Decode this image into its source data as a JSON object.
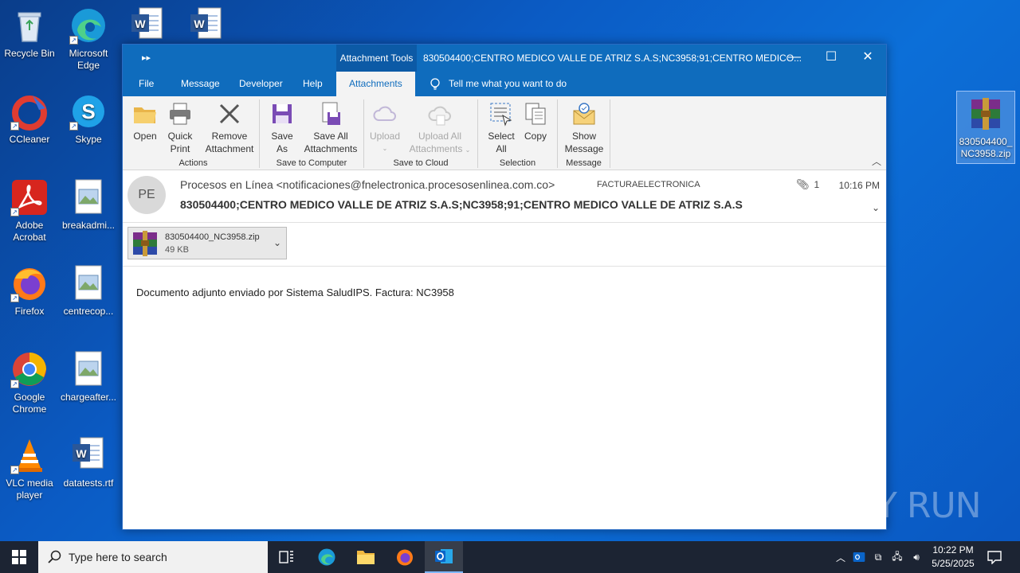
{
  "desktop": {
    "icons": [
      {
        "label": "Recycle Bin"
      },
      {
        "label": "Microsoft Edge"
      },
      {
        "label": "CCleaner"
      },
      {
        "label": "Skype"
      },
      {
        "label": "Adobe Acrobat"
      },
      {
        "label": "breakadmi..."
      },
      {
        "label": "Firefox"
      },
      {
        "label": "centrecop..."
      },
      {
        "label": "Google Chrome"
      },
      {
        "label": "chargeafter..."
      },
      {
        "label": "VLC media player"
      },
      {
        "label": "datatests.rtf"
      },
      {
        "label": "830504400_NC3958.zip"
      }
    ]
  },
  "window": {
    "contextual_tab": "Attachment Tools",
    "title": "830504400;CENTRO MEDICO VALLE DE ATRIZ S.A.S;NC3958;91;CENTRO MEDICO...",
    "tabs": [
      "File",
      "Message",
      "Developer",
      "Help",
      "Attachments"
    ],
    "active_tab": "Attachments",
    "tell_me": "Tell me what you want to do"
  },
  "ribbon": {
    "groups": {
      "actions": "Actions",
      "save_to_computer": "Save to Computer",
      "save_to_cloud": "Save to Cloud",
      "selection": "Selection",
      "message": "Message"
    },
    "buttons": {
      "open": "Open",
      "quick_print_1": "Quick",
      "quick_print_2": "Print",
      "remove_1": "Remove",
      "remove_2": "Attachment",
      "save_as_1": "Save",
      "save_as_2": "As",
      "save_all_1": "Save All",
      "save_all_2": "Attachments",
      "upload": "Upload",
      "upload_all_1": "Upload All",
      "upload_all_2": "Attachments",
      "select_all_1": "Select",
      "select_all_2": "All",
      "copy": "Copy",
      "show_message_1": "Show",
      "show_message_2": "Message"
    }
  },
  "email": {
    "avatar": "PE",
    "from": "Procesos en Línea <notificaciones@fnelectronica.procesosenlinea.com.co>",
    "to": "FACTURAELECTRONICA",
    "attachment_count": "1",
    "time": "10:16 PM",
    "subject": "830504400;CENTRO MEDICO VALLE DE ATRIZ S.A.S;NC3958;91;CENTRO MEDICO VALLE DE ATRIZ S.A.S",
    "attachment": {
      "name": "830504400_NC3958.zip",
      "size": "49 KB"
    },
    "body": "Documento adjunto enviado por Sistema SaludIPS. Factura: NC3958"
  },
  "taskbar": {
    "search_placeholder": "Type here to search",
    "time": "10:22 PM",
    "date": "5/25/2025"
  },
  "watermark": "ANY RUN"
}
